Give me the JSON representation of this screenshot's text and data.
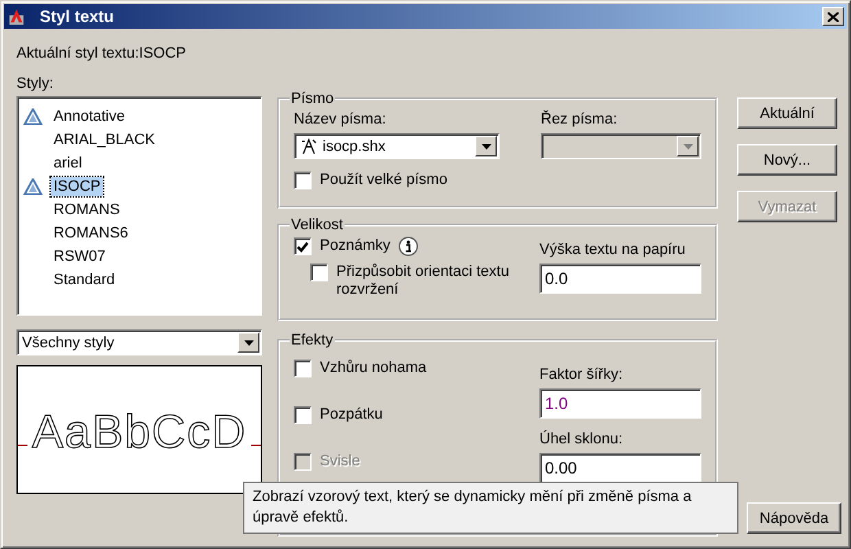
{
  "window": {
    "title": "Styl textu"
  },
  "current_style": "Aktuální styl textu:ISOCP",
  "styles": {
    "label": "Styly:",
    "items": [
      {
        "name": "Annotative",
        "annotative": true,
        "selected": false
      },
      {
        "name": "ARIAL_BLACK",
        "annotative": false,
        "selected": false
      },
      {
        "name": "ariel",
        "annotative": false,
        "selected": false
      },
      {
        "name": "ISOCP",
        "annotative": true,
        "selected": true
      },
      {
        "name": "ROMANS",
        "annotative": false,
        "selected": false
      },
      {
        "name": "ROMANS6",
        "annotative": false,
        "selected": false
      },
      {
        "name": "RSW07",
        "annotative": false,
        "selected": false
      },
      {
        "name": "Standard",
        "annotative": false,
        "selected": false
      }
    ]
  },
  "filter": {
    "value": "Všechny styly"
  },
  "preview": {
    "sample_text": "AaBbCcD"
  },
  "font_group": {
    "title": "Písmo",
    "font_name": {
      "label": "Název písma:",
      "value": "isocp.shx"
    },
    "font_style": {
      "label": "Řez písma:",
      "disabled": true
    },
    "big_font": {
      "label": "Použít velké písmo",
      "checked": false,
      "disabled": false
    }
  },
  "size_group": {
    "title": "Velikost",
    "annotative": {
      "label": "Poznámky",
      "checked": true,
      "disabled": false
    },
    "match_orientation": {
      "label": "Přizpůsobit orientaci textu rozvržení",
      "checked": false,
      "disabled": false
    },
    "paper_height": {
      "label": "Výška textu na papíru",
      "value": "0.0"
    }
  },
  "effects_group": {
    "title": "Efekty",
    "checkboxes": [
      {
        "label": "Vzhůru nohama",
        "checked": false,
        "disabled": false
      },
      {
        "label": "Pozpátku",
        "checked": false,
        "disabled": false
      },
      {
        "label": "Svisle",
        "checked": false,
        "disabled": true
      }
    ],
    "width_factor": {
      "label": "Faktor šířky:",
      "value": "1.0"
    },
    "oblique_angle": {
      "label": "Úhel sklonu:",
      "value": "0.00"
    }
  },
  "buttons": [
    {
      "label": "Aktuální",
      "disabled": false
    },
    {
      "label": "Nový...",
      "disabled": false
    },
    {
      "label": "Vymazat",
      "disabled": true
    }
  ],
  "help_button": {
    "label": "Nápověda"
  },
  "tooltip": "Zobrazí vzorový text, který se dynamicky mění při změně písma a úpravě efektů."
}
